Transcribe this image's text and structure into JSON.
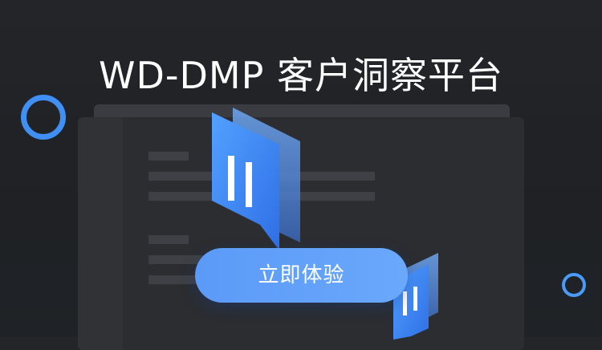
{
  "banner": {
    "title": "WD-DMP 客户洞察平台",
    "cta_label": "立即体验"
  },
  "icons": {
    "logo": "document-pause-logo-icon",
    "ring": "circle-ring-icon"
  },
  "colors": {
    "background": "#222428",
    "accent": "#3f8ff5",
    "cta": "#5b9af8",
    "text": "#ffffff"
  }
}
